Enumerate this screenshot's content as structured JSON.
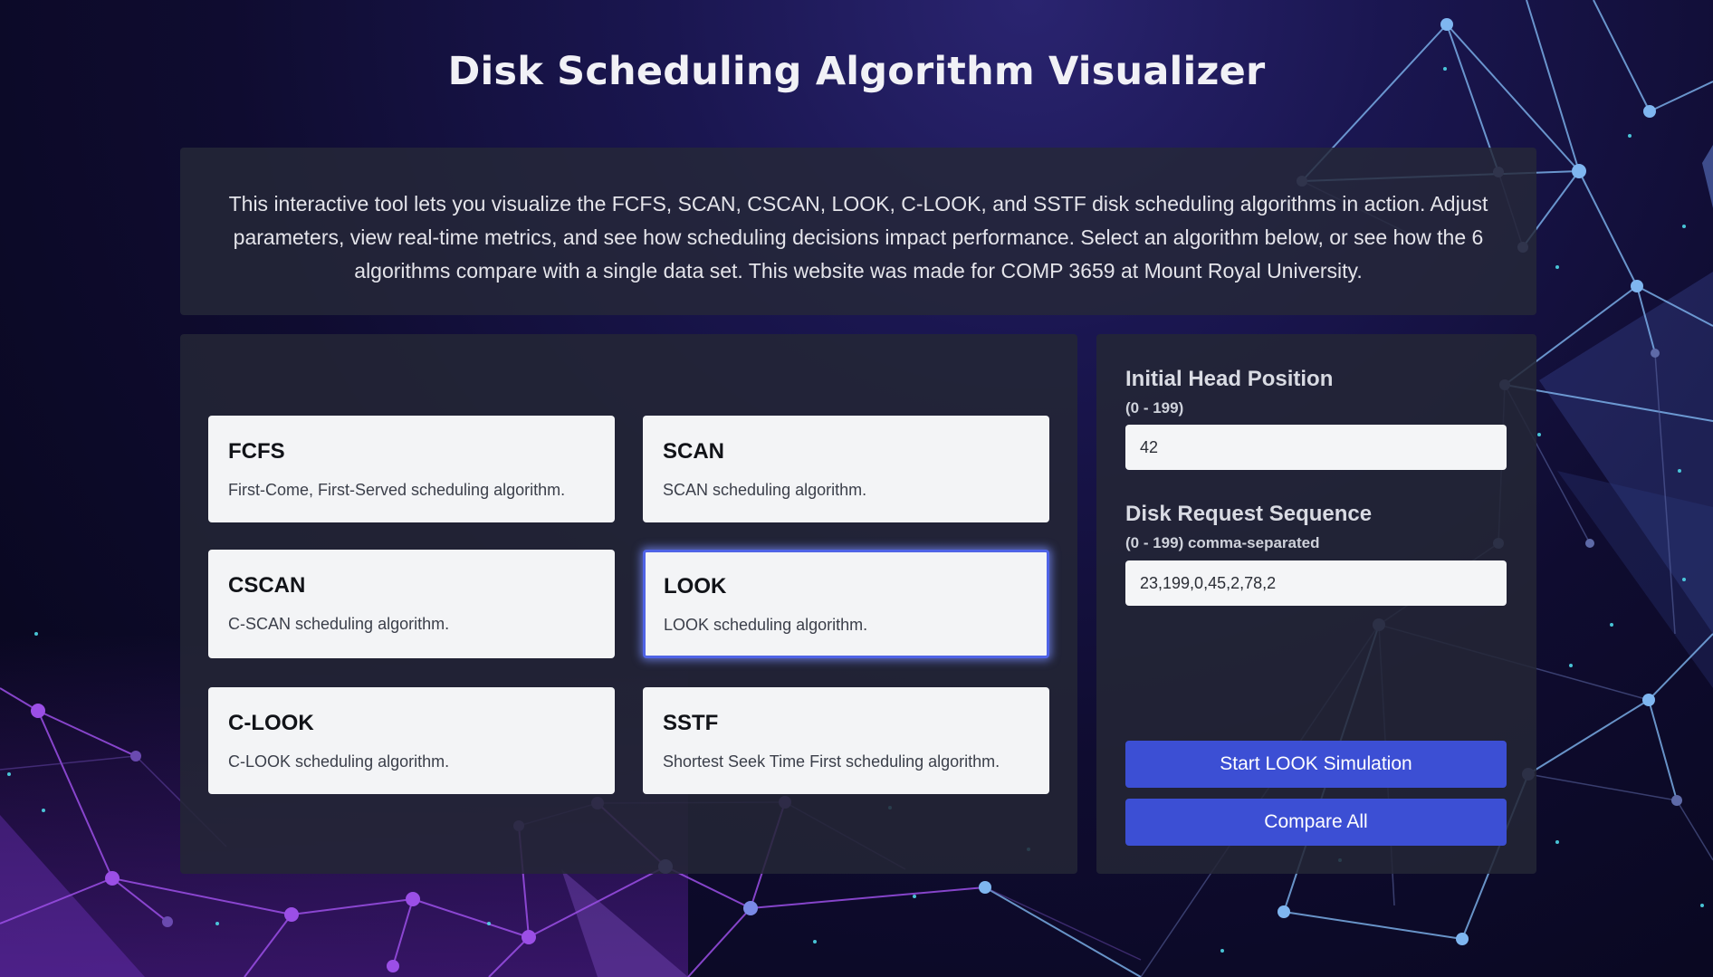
{
  "page": {
    "title": "Disk Scheduling Algorithm Visualizer",
    "intro": "This interactive tool lets you visualize the FCFS, SCAN, CSCAN, LOOK, C-LOOK, and SSTF disk scheduling algorithms in action. Adjust parameters, view real-time metrics, and see how scheduling decisions impact performance. Select an algorithm below, or see how the 6 algorithms compare with a single data set. This website was made for COMP 3659 at Mount Royal University."
  },
  "algorithms": [
    {
      "name": "FCFS",
      "description": "First-Come, First-Served scheduling algorithm.",
      "selected": false
    },
    {
      "name": "SCAN",
      "description": "SCAN scheduling algorithm.",
      "selected": false
    },
    {
      "name": "CSCAN",
      "description": "C-SCAN scheduling algorithm.",
      "selected": false
    },
    {
      "name": "LOOK",
      "description": "LOOK scheduling algorithm.",
      "selected": true
    },
    {
      "name": "C-LOOK",
      "description": "C-LOOK scheduling algorithm.",
      "selected": false
    },
    {
      "name": "SSTF",
      "description": "Shortest Seek Time First scheduling algorithm.",
      "selected": false
    }
  ],
  "params": {
    "head": {
      "label": "Initial Head Position",
      "range": "(0 - 199)",
      "value": "42"
    },
    "sequence": {
      "label": "Disk Request Sequence",
      "range": "(0 - 199) comma-separated",
      "value": "23,199,0,45,2,78,2"
    }
  },
  "buttons": {
    "start": "Start LOOK Simulation",
    "compare": "Compare All"
  },
  "colors": {
    "accent": "#3c4fd4",
    "selected_border": "#4f63e6",
    "card_bg": "#f3f4f6"
  }
}
